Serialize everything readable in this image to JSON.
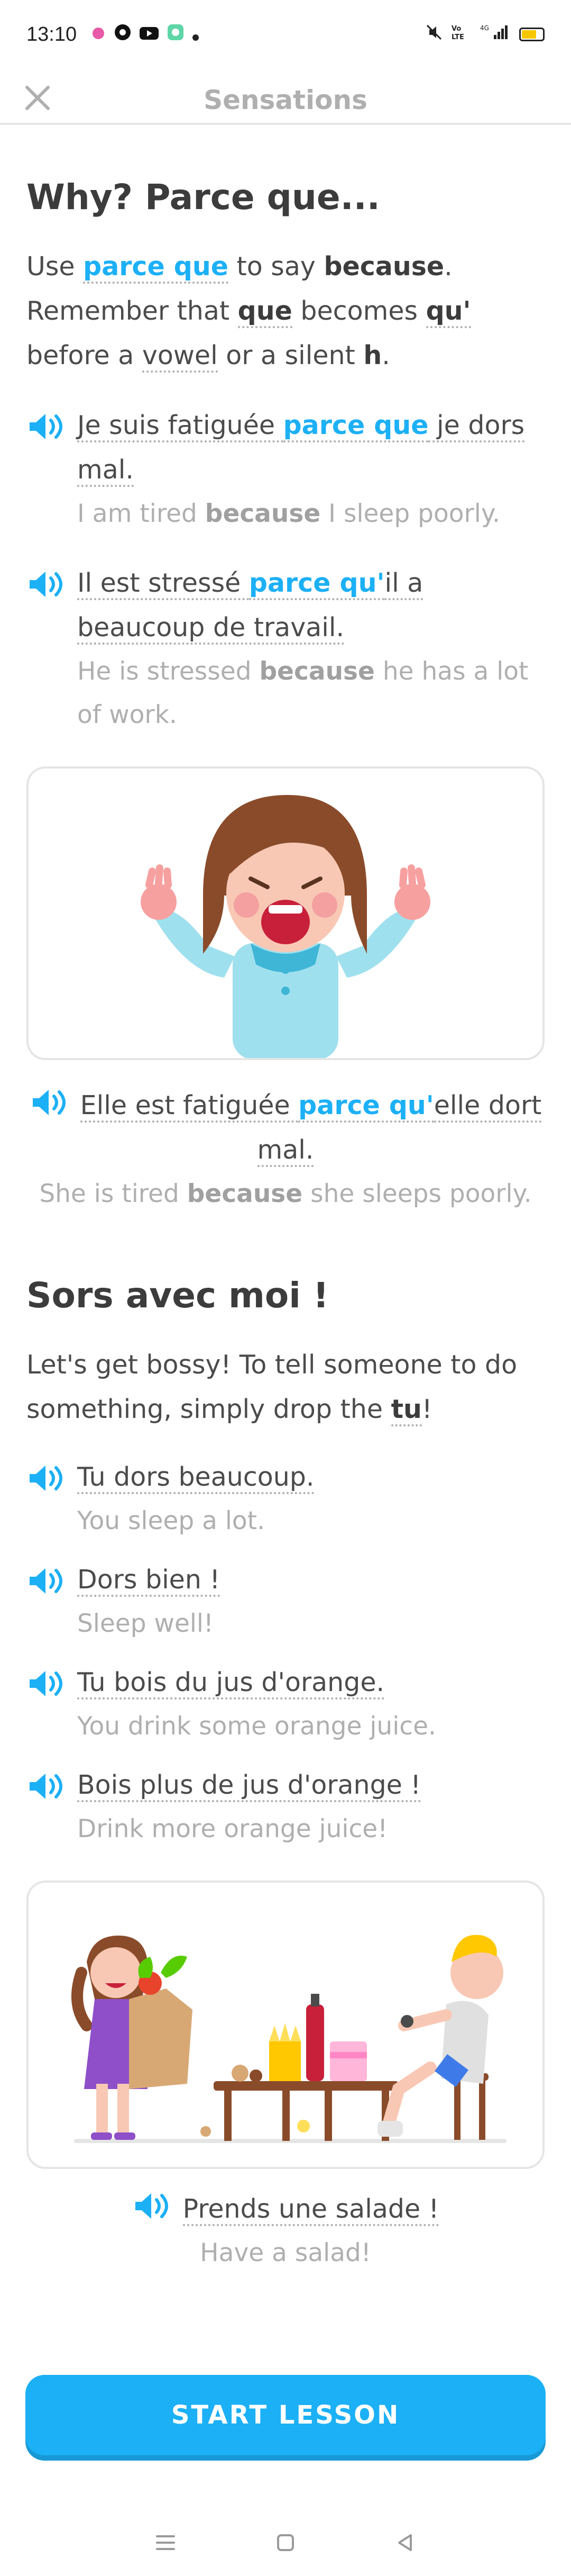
{
  "status_bar": {
    "time": "13:10",
    "network": "4G",
    "battery_level": 0.7
  },
  "header": {
    "title": "Sensations"
  },
  "section1": {
    "title": "Why? Parce que...",
    "intro": {
      "p1": "Use ",
      "k1": "parce que",
      "p2": " to say ",
      "k2": "because",
      "p3": ". Remember that ",
      "k3": "que",
      "p4": " becomes ",
      "k4": "qu'",
      "p5": " before a ",
      "k5": "vowel",
      "p6": " or a silent ",
      "k6": "h",
      "p7": "."
    },
    "examples": [
      {
        "fr_before": "Je suis fatiguée ",
        "fr_key": "parce que",
        "fr_after": " je dors mal.",
        "en_before": "I am tired ",
        "en_key": "because",
        "en_after": " I sleep poorly."
      },
      {
        "fr_before": "Il est stressé ",
        "fr_key": "parce qu'",
        "fr_after": "il a beaucoup de travail.",
        "en_before": "He is stressed ",
        "en_key": "because",
        "en_after": " he has a lot of work."
      }
    ],
    "illustration_example": {
      "fr_before": "Elle est fatiguée ",
      "fr_key": "parce qu'",
      "fr_after": "elle dort mal.",
      "en_before": "She is tired ",
      "en_key": "because",
      "en_after": " she sleeps poorly."
    }
  },
  "section2": {
    "title": "Sors avec moi !",
    "intro": {
      "p1": "Let's get bossy! To tell someone to do something, simply drop the ",
      "k1": "tu",
      "p2": "!"
    },
    "examples": [
      {
        "fr": "Tu dors beaucoup.",
        "en": "You sleep a lot."
      },
      {
        "fr": "Dors bien !",
        "en": "Sleep well!"
      },
      {
        "fr": "Tu bois du jus d'orange.",
        "en": "You drink some orange juice."
      },
      {
        "fr": "Bois plus de jus d'orange !",
        "en": "Drink more orange juice!"
      }
    ],
    "illustration_example": {
      "fr": "Prends une salade !",
      "en": "Have a salad!"
    }
  },
  "start_button": {
    "label": "START LESSON"
  },
  "colors": {
    "accent": "#1cb0f6",
    "accent_shadow": "#1899d6",
    "muted": "#afafaf",
    "text": "#4b4b4b",
    "border": "#e5e5e5"
  },
  "icons": [
    "close-icon",
    "speaker-icon",
    "menu-icon",
    "home-icon",
    "back-icon"
  ]
}
